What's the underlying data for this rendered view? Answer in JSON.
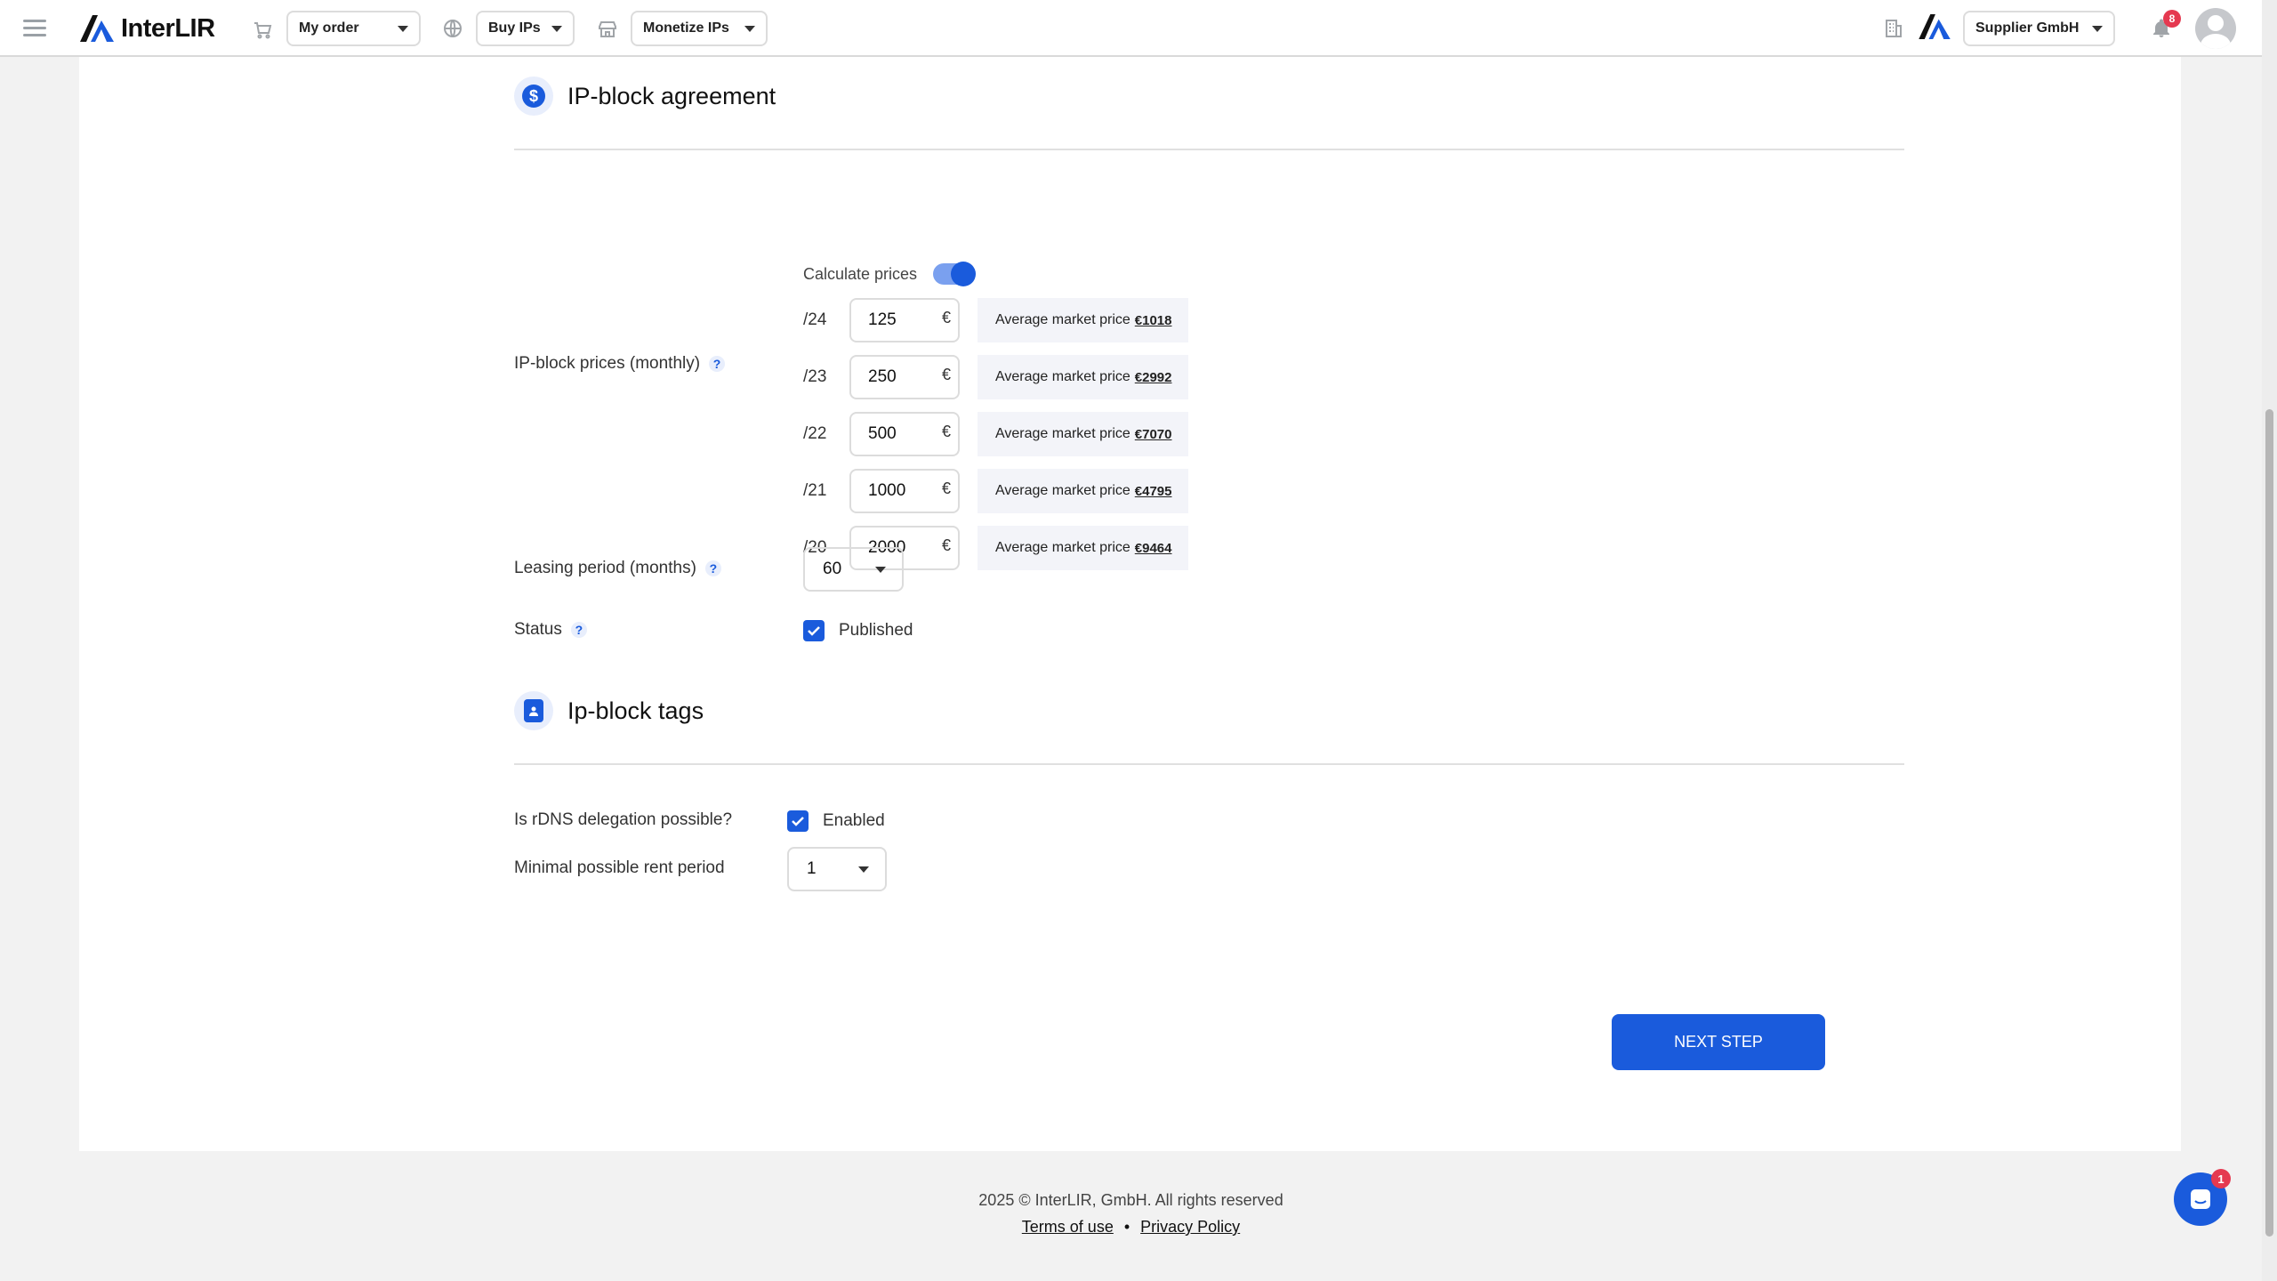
{
  "header": {
    "logo_text": "InterLIR",
    "nav": [
      {
        "label": "My order",
        "icon": "cart-icon"
      },
      {
        "label": "Buy IPs",
        "icon": "globe-icon"
      },
      {
        "label": "Monetize IPs",
        "icon": "store-icon"
      }
    ],
    "company": "Supplier GmbH",
    "notifications_count": "8"
  },
  "agreement": {
    "title": "IP-block agreement",
    "prices_label": "IP-block prices (monthly)",
    "calculate_prices_label": "Calculate prices",
    "calculate_prices_on": true,
    "currency_symbol": "€",
    "avg_label": "Average market price",
    "rows": [
      {
        "prefix": "/24",
        "value": "125",
        "avg": "€1018"
      },
      {
        "prefix": "/23",
        "value": "250",
        "avg": "€2992"
      },
      {
        "prefix": "/22",
        "value": "500",
        "avg": "€7070"
      },
      {
        "prefix": "/21",
        "value": "1000",
        "avg": "€4795"
      },
      {
        "prefix": "/20",
        "value": "2000",
        "avg": "€9464"
      }
    ],
    "leasing_label": "Leasing period (months)",
    "leasing_value": "60",
    "status_label": "Status",
    "status_value": "Published",
    "help_glyph": "?"
  },
  "tags": {
    "title": "Ip-block tags",
    "rdns_label": "Is rDNS delegation possible?",
    "rdns_value": "Enabled",
    "min_rent_label": "Minimal possible rent period",
    "min_rent_value": "1"
  },
  "next_button": "NEXT STEP",
  "footer": {
    "copyright": "2025 © InterLIR, GmbH. All rights reserved",
    "terms": "Terms of use",
    "separator": "•",
    "privacy": "Privacy Policy"
  },
  "chat": {
    "badge": "1"
  },
  "colors": {
    "accent": "#1a5bdc",
    "badge": "#e53950"
  }
}
